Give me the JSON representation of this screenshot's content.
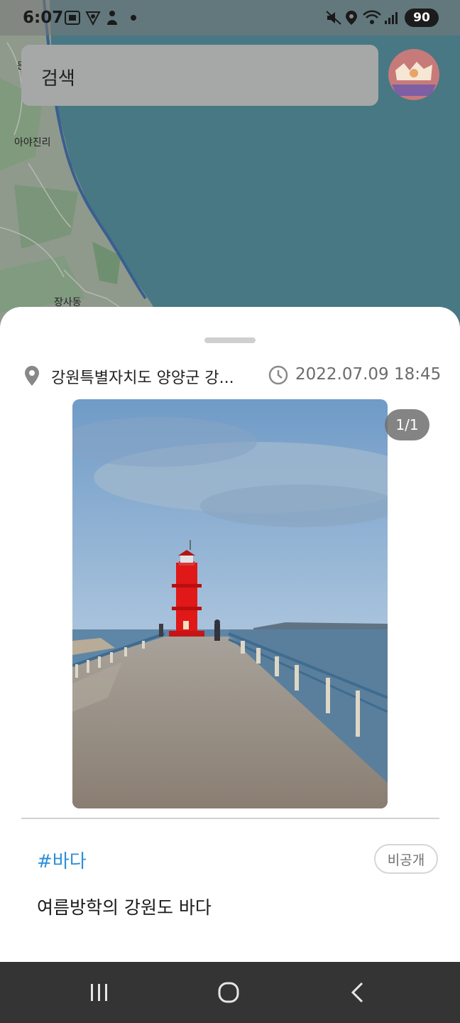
{
  "status_bar": {
    "time": "6:07",
    "battery": "90",
    "icons": [
      "screenshot-icon",
      "shield-icon",
      "fitness-icon",
      "dot-icon",
      "mute-icon",
      "location-icon",
      "wifi-icon",
      "signal-icon",
      "battery-icon"
    ]
  },
  "map": {
    "labels": [
      "든",
      "아야진리",
      "장사동"
    ]
  },
  "search": {
    "placeholder": "검색"
  },
  "sheet": {
    "location": "강원특별자치도 양양군 강...",
    "datetime": "2022.07.09 18:45",
    "page_indicator": "1/1",
    "hashtag": "#바다",
    "visibility": "비공개",
    "caption": "여름방학의 강원도 바다"
  },
  "colors": {
    "hashtag": "#2d8fd9",
    "lighthouse": "#e01818",
    "sea": "#477884",
    "nav_bar": "#343434"
  },
  "nav": {
    "icons": [
      "recent-apps-icon",
      "home-icon",
      "back-icon"
    ]
  }
}
